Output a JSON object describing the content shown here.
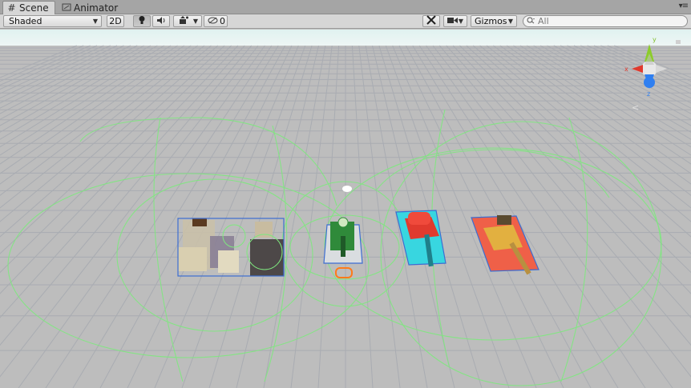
{
  "tabs": [
    {
      "label": "Scene",
      "icon": "hash-grid-icon",
      "active": true
    },
    {
      "label": "Animator",
      "icon": "animator-icon",
      "active": false
    }
  ],
  "toolbar": {
    "draw_mode": "Shaded",
    "mode_2d": "2D",
    "hidden_count": "0",
    "gizmos": "Gizmos",
    "search_placeholder": "All"
  },
  "gizmo": {
    "y_label": "y",
    "z_label": "z",
    "x_label": "x"
  },
  "colors": {
    "sky": "#e8f4f3",
    "ground": "#bcbcbc",
    "grid_line": "#a7aab1",
    "selection_wire": "#7fe87f",
    "axis_x": "#e03a2e",
    "axis_y": "#8ccc2a",
    "axis_z": "#2f7ff0"
  }
}
